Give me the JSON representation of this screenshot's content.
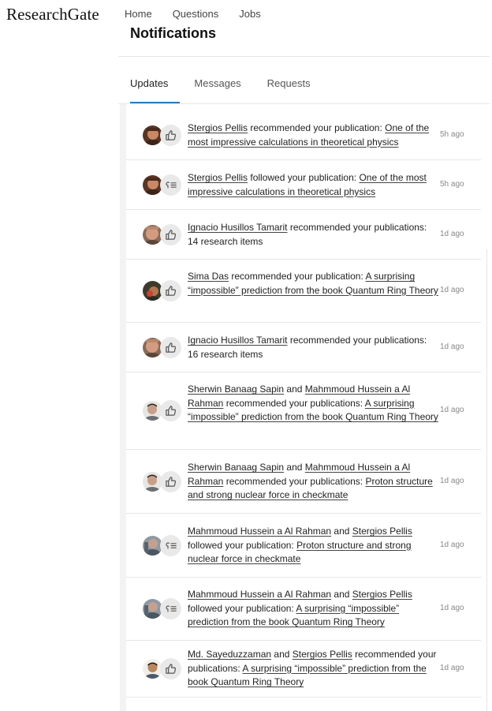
{
  "brand": {
    "logo": "ResearchGate"
  },
  "nav": {
    "home": "Home",
    "questions": "Questions",
    "jobs": "Jobs"
  },
  "page": {
    "title": "Notifications"
  },
  "tabs": [
    "Updates",
    "Messages",
    "Requests"
  ],
  "colors": {
    "accent": "#2b7bbf",
    "badge_bg": "#e9e9e9",
    "divider": "#e6e6e6"
  },
  "notifications": [
    {
      "avatar": "avatar-stergios",
      "icon": "thumbs-up-icon",
      "p1": "Stergios Pellis",
      "p2": " recommended your publication: ",
      "p3": "One of the most impressive calculations in theoretical physics",
      "p4": "",
      "p5": "",
      "p6": "",
      "time": "5h ago"
    },
    {
      "avatar": "avatar-stergios",
      "icon": "follow-icon",
      "p1": "Stergios Pellis",
      "p2": " followed your publication: ",
      "p3": "One of the most impressive calculations in theoretical physics",
      "p4": "",
      "p5": "",
      "p6": "",
      "time": "5h ago"
    },
    {
      "avatar": "avatar-ignacio",
      "icon": "thumbs-up-icon",
      "p1": "Ignacio Husillos Tamarit",
      "p2": " recommended your publications: 14 research items",
      "p3": "",
      "p4": "",
      "p5": "",
      "p6": "",
      "time": "1d ago"
    },
    {
      "avatar": "avatar-sima",
      "icon": "thumbs-up-icon",
      "p1": "Sima Das",
      "p2": " recommended your publication: ",
      "p3": "A surprising “impossible” prediction from the book Quantum Ring Theory",
      "p4": "",
      "p5": "",
      "p6": "",
      "time": "1d ago"
    },
    {
      "avatar": "avatar-ignacio",
      "icon": "thumbs-up-icon",
      "p1": "Ignacio Husillos Tamarit",
      "p2": " recommended your publications: 16 research items",
      "p3": "",
      "p4": "",
      "p5": "",
      "p6": "",
      "time": "1d ago"
    },
    {
      "avatar": "avatar-sherwin",
      "icon": "thumbs-up-icon",
      "p1": "Sherwin Banaag Sapin",
      "p2": " and ",
      "p3": "Mahmmoud Hussein a Al Rahman",
      "p4": " recommended your publications: ",
      "p5": "A surprising “impossible” prediction from the book Quantum Ring Theory",
      "p6": "",
      "time": "1d ago"
    },
    {
      "avatar": "avatar-sherwin",
      "icon": "thumbs-up-icon",
      "p1": "Sherwin Banaag Sapin",
      "p2": " and ",
      "p3": "Mahmmoud Hussein a Al Rahman",
      "p4": " recommended your publications: ",
      "p5": "Proton structure and strong nuclear force in checkmate",
      "p6": "",
      "time": "1d ago"
    },
    {
      "avatar": "avatar-mahmmoud",
      "icon": "follow-icon",
      "p1": "Mahmmoud Hussein a Al Rahman",
      "p2": " and ",
      "p3": "Stergios Pellis",
      "p4": " followed your publication: ",
      "p5": "Proton structure and strong nuclear force in checkmate",
      "p6": "",
      "time": "1d ago"
    },
    {
      "avatar": "avatar-mahmmoud",
      "icon": "follow-icon",
      "p1": "Mahmmoud Hussein a Al Rahman",
      "p2": " and ",
      "p3": "Stergios Pellis",
      "p4": " followed your publication: ",
      "p5": "A surprising “impossible” prediction from the book Quantum Ring Theory",
      "p6": "",
      "time": "1d ago"
    },
    {
      "avatar": "avatar-sayeduzzaman",
      "icon": "thumbs-up-icon",
      "p1": "Md. Sayeduzzaman",
      "p2": " and ",
      "p3": "Stergios Pellis",
      "p4": " recommended your publications: ",
      "p5": "A surprising “impossible” prediction from the book Quantum Ring Theory",
      "p6": "",
      "time": "1d ago"
    }
  ]
}
